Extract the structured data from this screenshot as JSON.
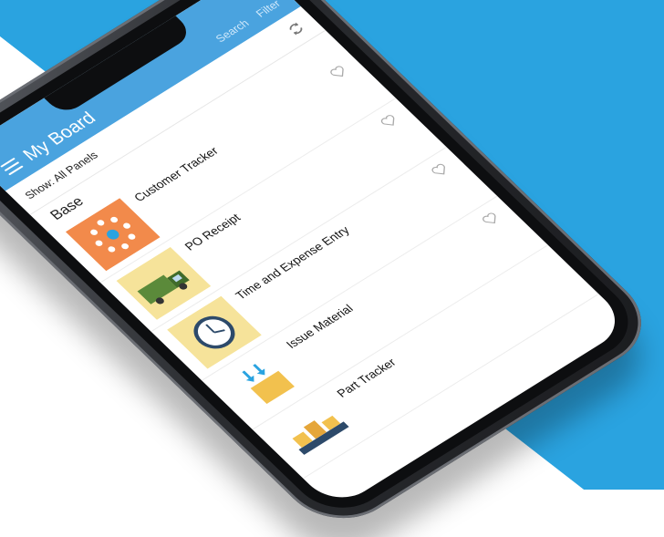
{
  "app": {
    "title": "My Board",
    "search_label": "Search",
    "filter_label": "Filter"
  },
  "toolbar": {
    "show_label": "Show: All Panels"
  },
  "section": {
    "title": "Base"
  },
  "panels": [
    {
      "name": "Customer Tracker",
      "icon": "network-hub-icon"
    },
    {
      "name": "PO Receipt",
      "icon": "delivery-truck-icon"
    },
    {
      "name": "Time and Expense Entry",
      "icon": "clock-icon"
    },
    {
      "name": "Issue Material",
      "icon": "box-download-icon"
    },
    {
      "name": "Part Tracker",
      "icon": "conveyor-boxes-icon"
    }
  ],
  "colors": {
    "background_blue": "#2aa3e0",
    "header_blue": "#4aa3df",
    "phone_body": "#2b2d31"
  }
}
